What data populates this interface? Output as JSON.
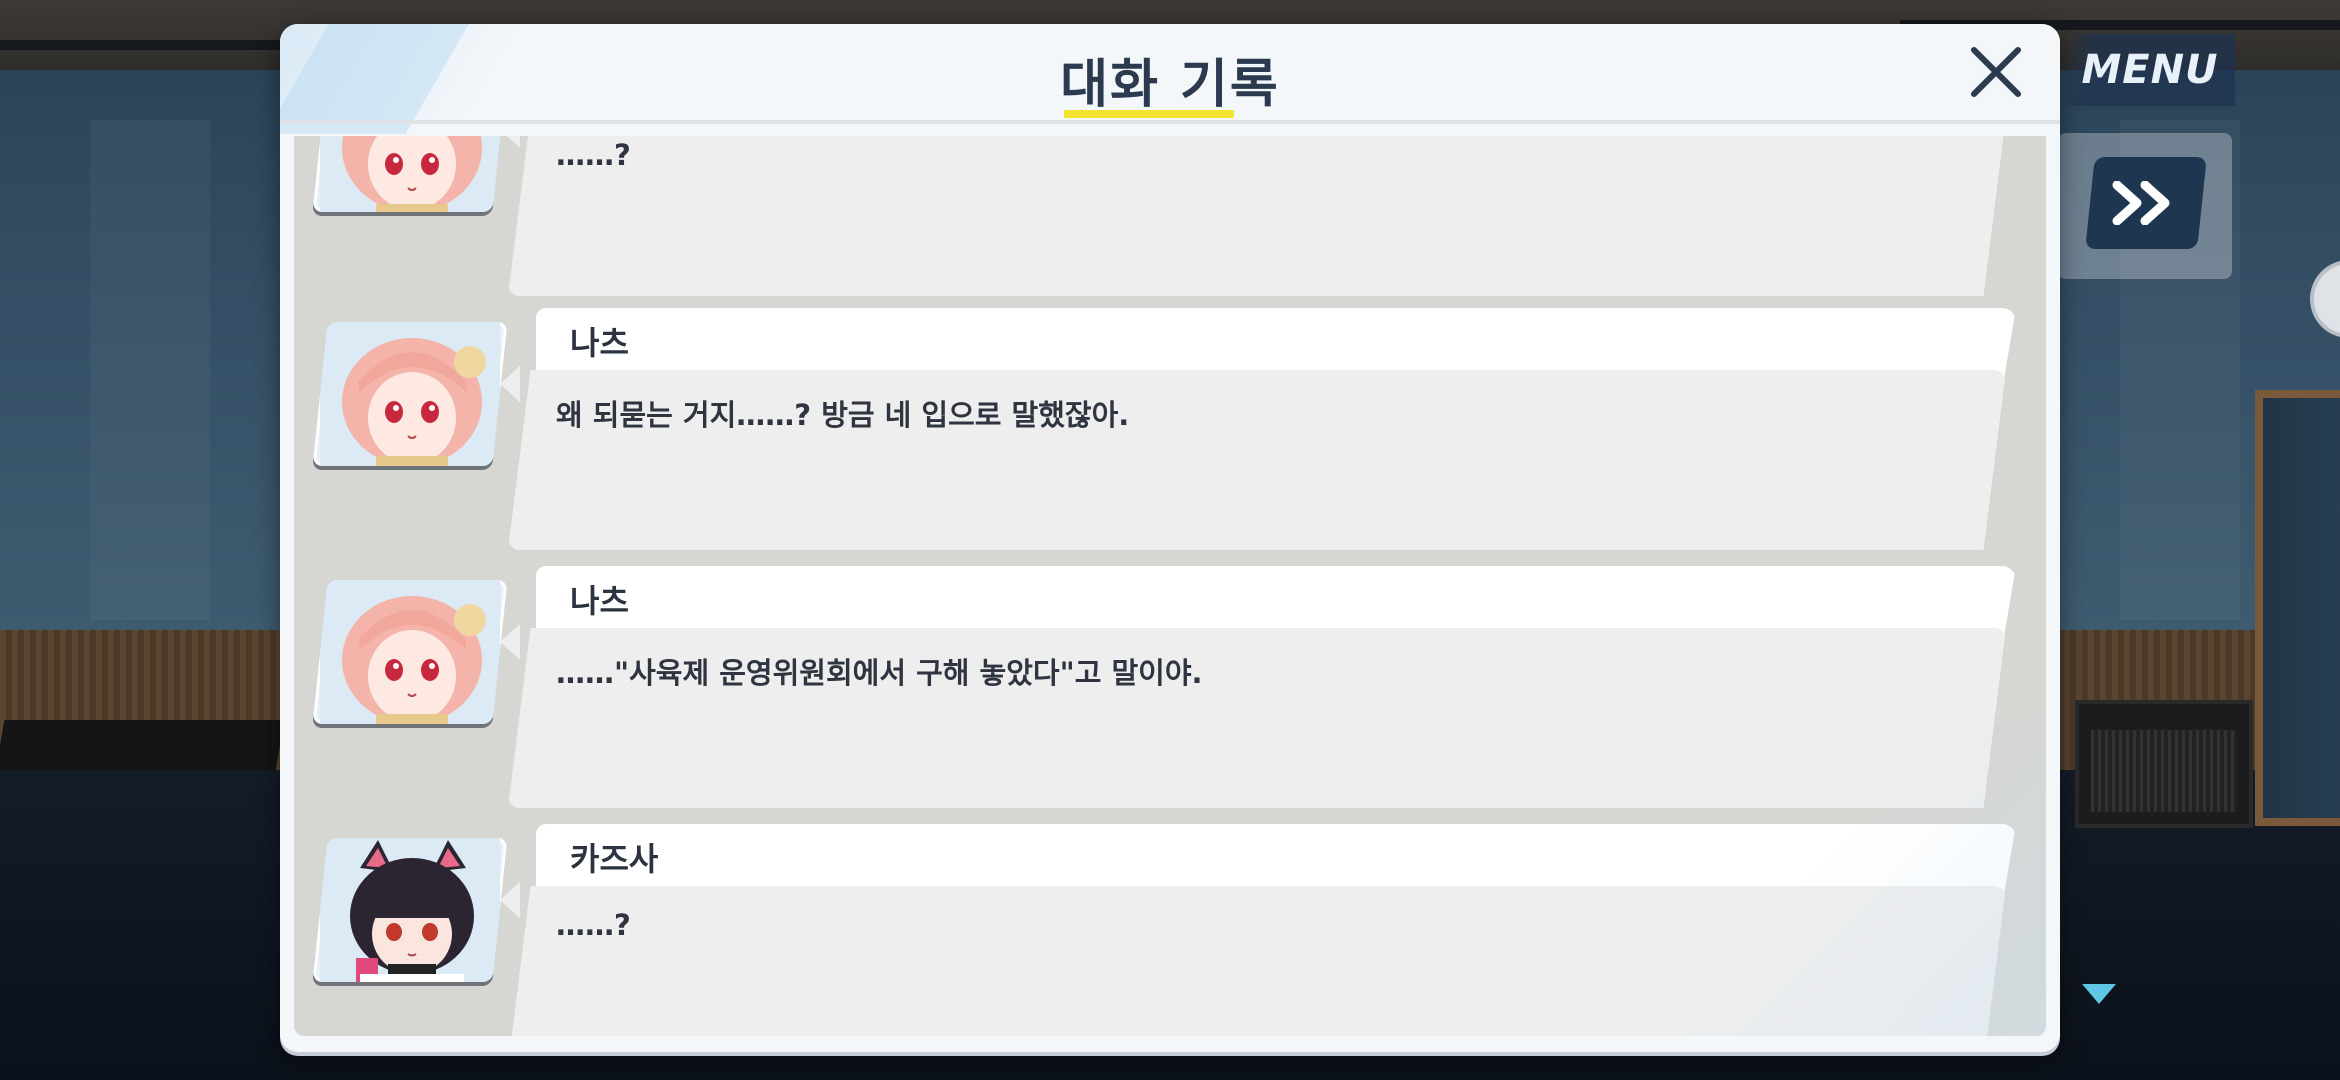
{
  "hud": {
    "menu_label": "MENU"
  },
  "dialog": {
    "title": "대화 기록",
    "entries": [
      {
        "speaker": "",
        "message": "……?",
        "portrait": "pink-hair-girl"
      },
      {
        "speaker": "나츠",
        "message": "왜 되묻는 거지……? 방금 네 입으로 말했잖아.",
        "portrait": "pink-hair-girl"
      },
      {
        "speaker": "나츠",
        "message": "……\"사육제 운영위원회에서 구해 놓았다\"고 말이야.",
        "portrait": "pink-hair-girl"
      },
      {
        "speaker": "카즈사",
        "message": "……?",
        "portrait": "black-hair-cat-ear-girl"
      }
    ]
  },
  "colors": {
    "title_text": "#2b3a4e",
    "title_underline": "#f5e331",
    "accent_button": "#1f3650",
    "scroll_indicator": "#5ec7e6"
  }
}
